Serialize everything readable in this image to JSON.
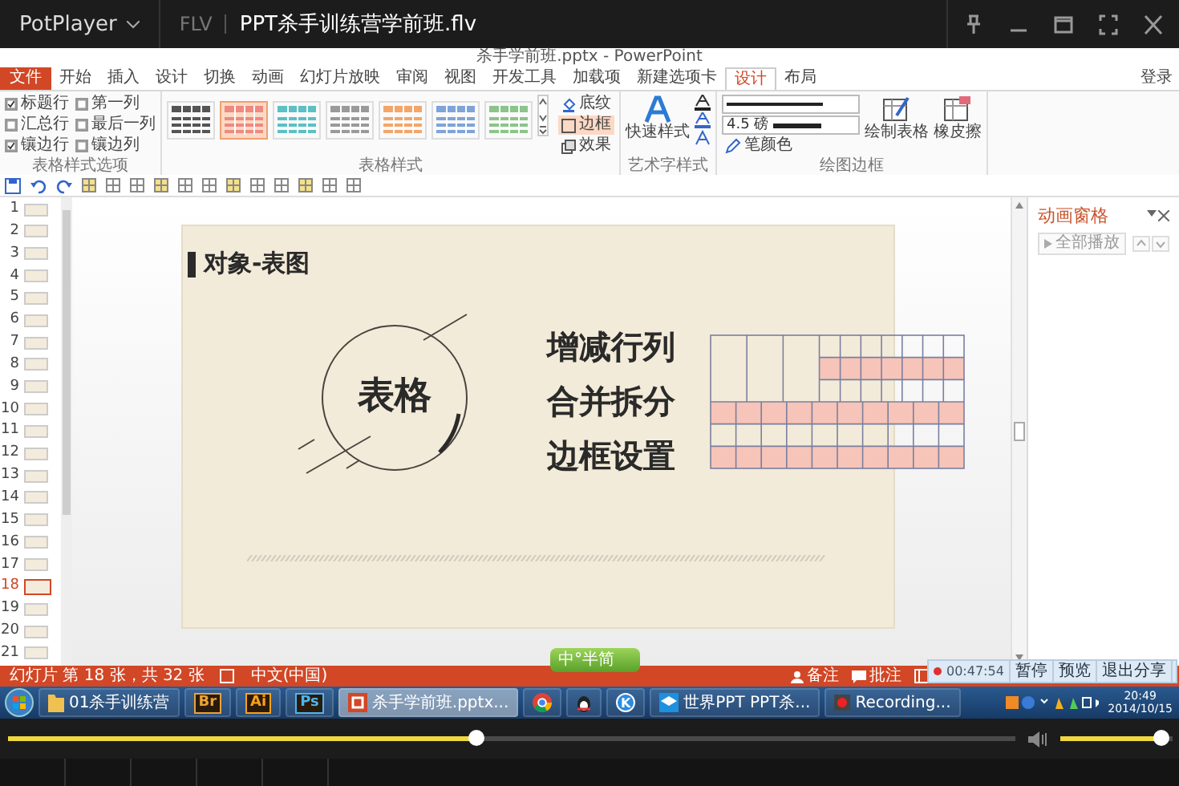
{
  "player": {
    "app": "PotPlayer",
    "format": "FLV",
    "file": "PPT杀手训练营学前班.flv"
  },
  "ppt": {
    "title": "杀手学前班.pptx - PowerPoint",
    "login": "登录",
    "tabs": [
      {
        "label": "文件",
        "kind": "file",
        "selected": false
      },
      {
        "label": "开始",
        "kind": "tab",
        "selected": false
      },
      {
        "label": "插入",
        "kind": "tab",
        "selected": false
      },
      {
        "label": "设计",
        "kind": "tab",
        "selected": false
      },
      {
        "label": "切换",
        "kind": "tab",
        "selected": false
      },
      {
        "label": "动画",
        "kind": "tab",
        "selected": false
      },
      {
        "label": "幻灯片放映",
        "kind": "tab",
        "selected": false
      },
      {
        "label": "审阅",
        "kind": "tab",
        "selected": false
      },
      {
        "label": "视图",
        "kind": "tab",
        "selected": false
      },
      {
        "label": "开发工具",
        "kind": "tab",
        "selected": false
      },
      {
        "label": "加载项",
        "kind": "tab",
        "selected": false
      },
      {
        "label": "新建选项卡",
        "kind": "tab",
        "selected": false
      },
      {
        "label": "设计",
        "kind": "tab",
        "selected": true
      },
      {
        "label": "布局",
        "kind": "tab",
        "selected": false
      }
    ]
  },
  "ribbon": {
    "options": [
      {
        "label": "标题行",
        "checked": true
      },
      {
        "label": "第一列",
        "checked": false
      },
      {
        "label": "汇总行",
        "checked": false
      },
      {
        "label": "最后一列",
        "checked": false
      },
      {
        "label": "镶边行",
        "checked": true
      },
      {
        "label": "镶边列",
        "checked": false
      }
    ],
    "options_group": "表格样式选项",
    "swatches": [
      {
        "color": "#555555",
        "selected": false
      },
      {
        "color": "#ee8a80",
        "selected": true
      },
      {
        "color": "#5cc0c4",
        "selected": false
      },
      {
        "color": "#9a9a9a",
        "selected": false
      },
      {
        "color": "#f2a66a",
        "selected": false
      },
      {
        "color": "#7fa4d8",
        "selected": false
      },
      {
        "color": "#8cc48a",
        "selected": false
      }
    ],
    "styles_group": "表格样式",
    "shading": "底纹",
    "border": "边框",
    "effects": "效果",
    "quick_styles": "快速样式",
    "art_group": "艺术字样式",
    "pen_weight": "4.5 磅",
    "pen_color": "笔颜色",
    "draw_table": "绘制表格",
    "eraser": "橡皮擦",
    "borders_group": "绘图边框"
  },
  "slides": [
    {
      "number": "1",
      "selected": false
    },
    {
      "number": "2",
      "selected": false
    },
    {
      "number": "3",
      "selected": false
    },
    {
      "number": "4",
      "selected": false
    },
    {
      "number": "5",
      "selected": false
    },
    {
      "number": "6",
      "selected": false
    },
    {
      "number": "7",
      "selected": false
    },
    {
      "number": "8",
      "selected": false
    },
    {
      "number": "9",
      "selected": false
    },
    {
      "number": "10",
      "selected": false
    },
    {
      "number": "11",
      "selected": false
    },
    {
      "number": "12",
      "selected": false
    },
    {
      "number": "13",
      "selected": false
    },
    {
      "number": "14",
      "selected": false
    },
    {
      "number": "15",
      "selected": false
    },
    {
      "number": "16",
      "selected": false
    },
    {
      "number": "17",
      "selected": false
    },
    {
      "number": "18",
      "selected": true
    },
    {
      "number": "19",
      "selected": false
    },
    {
      "number": "20",
      "selected": false
    },
    {
      "number": "21",
      "selected": false
    }
  ],
  "slide": {
    "heading": "对象-表图",
    "circle_text": "表格",
    "lines": [
      "增减行列",
      "合并拆分",
      "边框设置"
    ]
  },
  "animation_pane": {
    "title": "动画窗格",
    "play_all": "全部播放"
  },
  "status": {
    "slide_info": "幻灯片 第 18 张，共 32 张",
    "language": "中文(中国)",
    "notes": "备注",
    "comments": "批注"
  },
  "ime_badge": "中°半简",
  "recorder": {
    "time": "00:47:54",
    "buttons": [
      "暂停",
      "预览",
      "退出分享"
    ]
  },
  "taskbar": {
    "items": [
      {
        "kind": "folder",
        "label": "01杀手训练营",
        "selected": false
      },
      {
        "kind": "badge",
        "label": "Br",
        "color": "#e8a33a",
        "selected": false
      },
      {
        "kind": "badge",
        "label": "Ai",
        "color": "#f7a21b",
        "selected": false
      },
      {
        "kind": "badge",
        "label": "Ps",
        "color": "#4fb4f0",
        "selected": false
      },
      {
        "kind": "ppt",
        "label": "杀手学前班.pptx...",
        "selected": true
      },
      {
        "kind": "chrome",
        "selected": false
      },
      {
        "kind": "qq",
        "selected": false
      },
      {
        "kind": "k",
        "label": "K",
        "selected": false
      },
      {
        "kind": "edu",
        "label": "世界PPT  PPT杀...",
        "selected": false
      },
      {
        "kind": "recording",
        "label": "Recording...",
        "selected": false
      }
    ],
    "time": "20:49",
    "date": "2014/10/15"
  },
  "seek": {
    "level": 0.465
  },
  "volume": {
    "level": 0.9
  }
}
